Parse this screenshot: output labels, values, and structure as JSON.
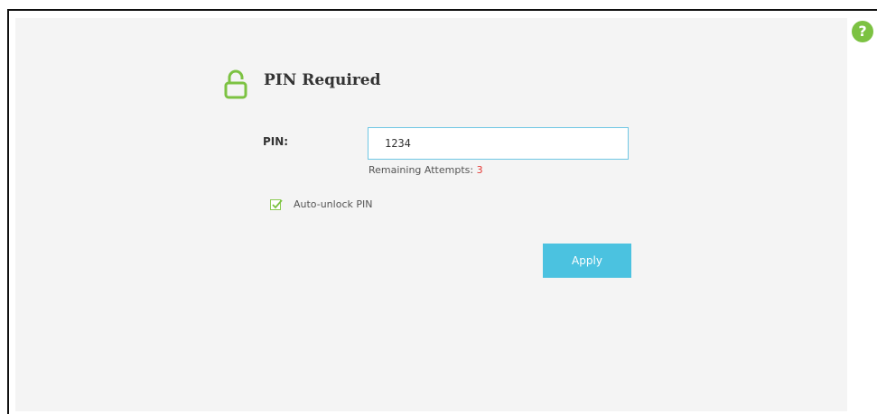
{
  "header": {
    "title": "PIN Required",
    "help_icon": "help-icon",
    "help_glyph": "?",
    "lock_icon": "lock-icon"
  },
  "form": {
    "pin_label": "PIN:",
    "pin_value": "1234",
    "remaining_label": "Remaining Attempts:",
    "remaining_count": "3",
    "auto_unlock_label": "Auto-unlock PIN",
    "auto_unlock_checked": true,
    "apply_label": "Apply"
  },
  "colors": {
    "accent_green": "#7cc242",
    "accent_blue": "#4bc2e0",
    "warning_red": "#e53935"
  }
}
